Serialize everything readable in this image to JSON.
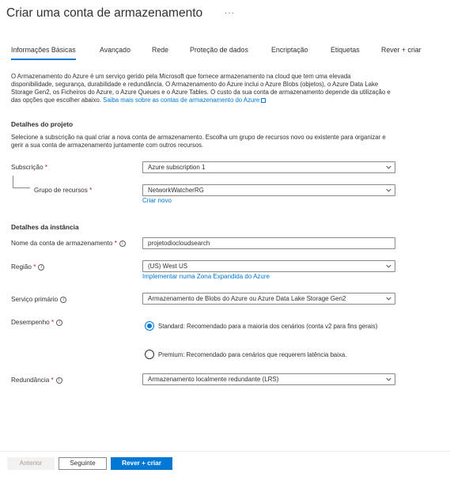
{
  "header": {
    "title": "Criar uma conta de armazenamento",
    "more": "···"
  },
  "tabs": [
    {
      "label": "Informações Básicas",
      "active": true
    },
    {
      "label": "Avançado"
    },
    {
      "label": "Rede"
    },
    {
      "label": "Proteção de dados"
    },
    {
      "label": "Encriptação"
    },
    {
      "label": "Etiquetas"
    },
    {
      "label": "Rever + criar"
    }
  ],
  "intro": {
    "text": "O Armazenamento do Azure é um serviço gerido pela Microsoft que fornece armazenamento na cloud que tem uma elevada disponibilidade, segurança, durabilidade e redundância. O Armazenamento do Azure inclui o Azure Blobs (objetos), o Azure Data Lake Storage Gen2, os Ficheiros do Azure, o Azure Queues e o Azure Tables. O custo da sua conta de armazenamento depende da utilização e das opções que escolher abaixo.",
    "link": "Saiba mais sobre as contas de armazenamento do Azure"
  },
  "project": {
    "heading": "Detalhes do projeto",
    "desc": "Selecione a subscrição na qual criar a nova conta de armazenamento. Escolha um grupo de recursos novo ou existente para organizar e gerir a sua conta de armazenamento juntamente com outros recursos.",
    "subscription_label": "Subscrição",
    "subscription_value": "Azure subscription 1",
    "rg_label": "Grupo de recursos",
    "rg_value": "NetworkWatcherRG",
    "rg_new_link": "Criar novo"
  },
  "instance": {
    "heading": "Detalhes da instância",
    "name_label": "Nome da conta de armazenamento",
    "name_value": "projetodiocloudsearch",
    "region_label": "Região",
    "region_value": "(US) West US",
    "region_link": "Implementar numa Zona Expandida do Azure",
    "service_label": "Serviço primário",
    "service_value": "Armazenamento de Blobs do Azure ou Azure Data Lake Storage Gen2",
    "perf_label": "Desempenho",
    "perf_standard": "Standard: Recomendado para a maioria dos cenários (conta v2 para fins gerais)",
    "perf_premium": "Premium: Recomendado para cenários que requerem latência baixa.",
    "perf_selected": "standard",
    "redundancy_label": "Redundância",
    "redundancy_value": "Armazenamento localmente redundante (LRS)"
  },
  "required_mark": "*",
  "info_mark": "i",
  "footer": {
    "prev": "Anterior",
    "next": "Seguinte",
    "review": "Rever + criar"
  },
  "colors": {
    "accent": "#0078d4",
    "required": "#a4262c",
    "border": "#8a8886"
  }
}
